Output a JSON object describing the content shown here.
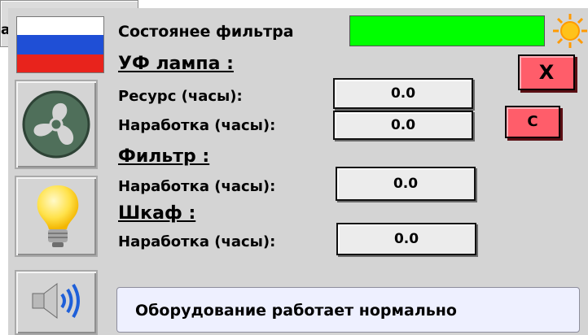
{
  "background_window": {
    "title_fragment": "a"
  },
  "header": {
    "filter_state_label": "Состоянее фильтра",
    "filter_state_color": "#00ff00"
  },
  "uv_lamp": {
    "title": "УФ лампа :",
    "resource_label": "Ресурс (часы):",
    "resource_value": "0.0",
    "runtime_label": "Наработка (часы):",
    "runtime_value": "0.0"
  },
  "filter": {
    "title": "Фильтр :",
    "runtime_label": "Наработка (часы):",
    "runtime_value": "0.0"
  },
  "cabinet": {
    "title": "Шкаф :",
    "runtime_label": "Наработка (часы):",
    "runtime_value": "0.0"
  },
  "buttons": {
    "close_label": "X",
    "reset_label": "C"
  },
  "status": {
    "message": "Оборудование работает нормально"
  },
  "icons": {
    "flag": "russian-flag-icon",
    "fan": "fan-icon",
    "lamp": "light-bulb-icon",
    "sound": "speaker-icon",
    "sun": "sun-icon"
  },
  "colors": {
    "panel": "#d4d4d4",
    "accent_red": "#ff5d6a",
    "status_bg": "#eef0ff"
  }
}
